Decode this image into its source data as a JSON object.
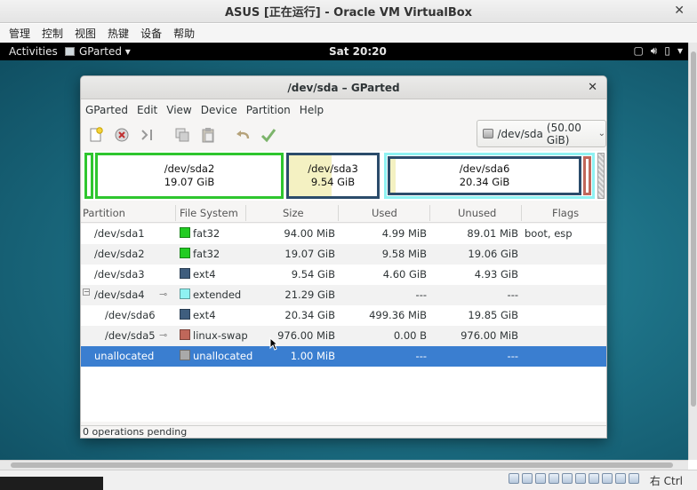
{
  "vbox": {
    "title": "ASUS [正在运行] - Oracle VM VirtualBox",
    "menu": [
      "管理",
      "控制",
      "视图",
      "热键",
      "设备",
      "帮助"
    ],
    "host_key": "右 Ctrl"
  },
  "topbar": {
    "activities": "Activities",
    "app": "GParted ▾",
    "clock": "Sat 20:20"
  },
  "gparted": {
    "title": "/dev/sda – GParted",
    "menu": [
      "GParted",
      "Edit",
      "View",
      "Device",
      "Partition",
      "Help"
    ],
    "device": "/dev/sda",
    "device_size": "(50.00 GiB)",
    "graph": [
      {
        "name": "/dev/sda2",
        "size": "19.07 GiB",
        "color": "#2ec62e"
      },
      {
        "name": "/dev/sda3",
        "size": "9.54 GiB",
        "color": "#2b4c6b"
      },
      {
        "name": "/dev/sda6",
        "size": "20.34 GiB",
        "color": "#2b4c6b"
      }
    ],
    "columns": [
      "Partition",
      "File System",
      "Size",
      "Used",
      "Unused",
      "Flags"
    ],
    "rows": [
      {
        "partition": "/dev/sda1",
        "fs": "fat32",
        "fs_color": "#22cc22",
        "size": "94.00 MiB",
        "used": "4.99 MiB",
        "unused": "89.01 MiB",
        "flags": "boot, esp"
      },
      {
        "partition": "/dev/sda2",
        "fs": "fat32",
        "fs_color": "#22cc22",
        "size": "19.07 GiB",
        "used": "9.58 MiB",
        "unused": "19.06 GiB",
        "flags": ""
      },
      {
        "partition": "/dev/sda3",
        "fs": "ext4",
        "fs_color": "#3f5e7e",
        "size": "9.54 GiB",
        "used": "4.60 GiB",
        "unused": "4.93 GiB",
        "flags": ""
      },
      {
        "partition": "/dev/sda4",
        "fs": "extended",
        "fs_color": "#8ff2f2",
        "size": "21.29 GiB",
        "used": "---",
        "unused": "---",
        "flags": ""
      },
      {
        "partition": "/dev/sda6",
        "fs": "ext4",
        "fs_color": "#3f5e7e",
        "size": "20.34 GiB",
        "used": "499.36 MiB",
        "unused": "19.85 GiB",
        "flags": ""
      },
      {
        "partition": "/dev/sda5",
        "fs": "linux-swap",
        "fs_color": "#c0675a",
        "size": "976.00 MiB",
        "used": "0.00 B",
        "unused": "976.00 MiB",
        "flags": ""
      },
      {
        "partition": "unallocated",
        "fs": "unallocated",
        "fs_color": "#a9a9a9",
        "size": "1.00 MiB",
        "used": "---",
        "unused": "---",
        "flags": ""
      }
    ],
    "status": "0 operations pending"
  }
}
